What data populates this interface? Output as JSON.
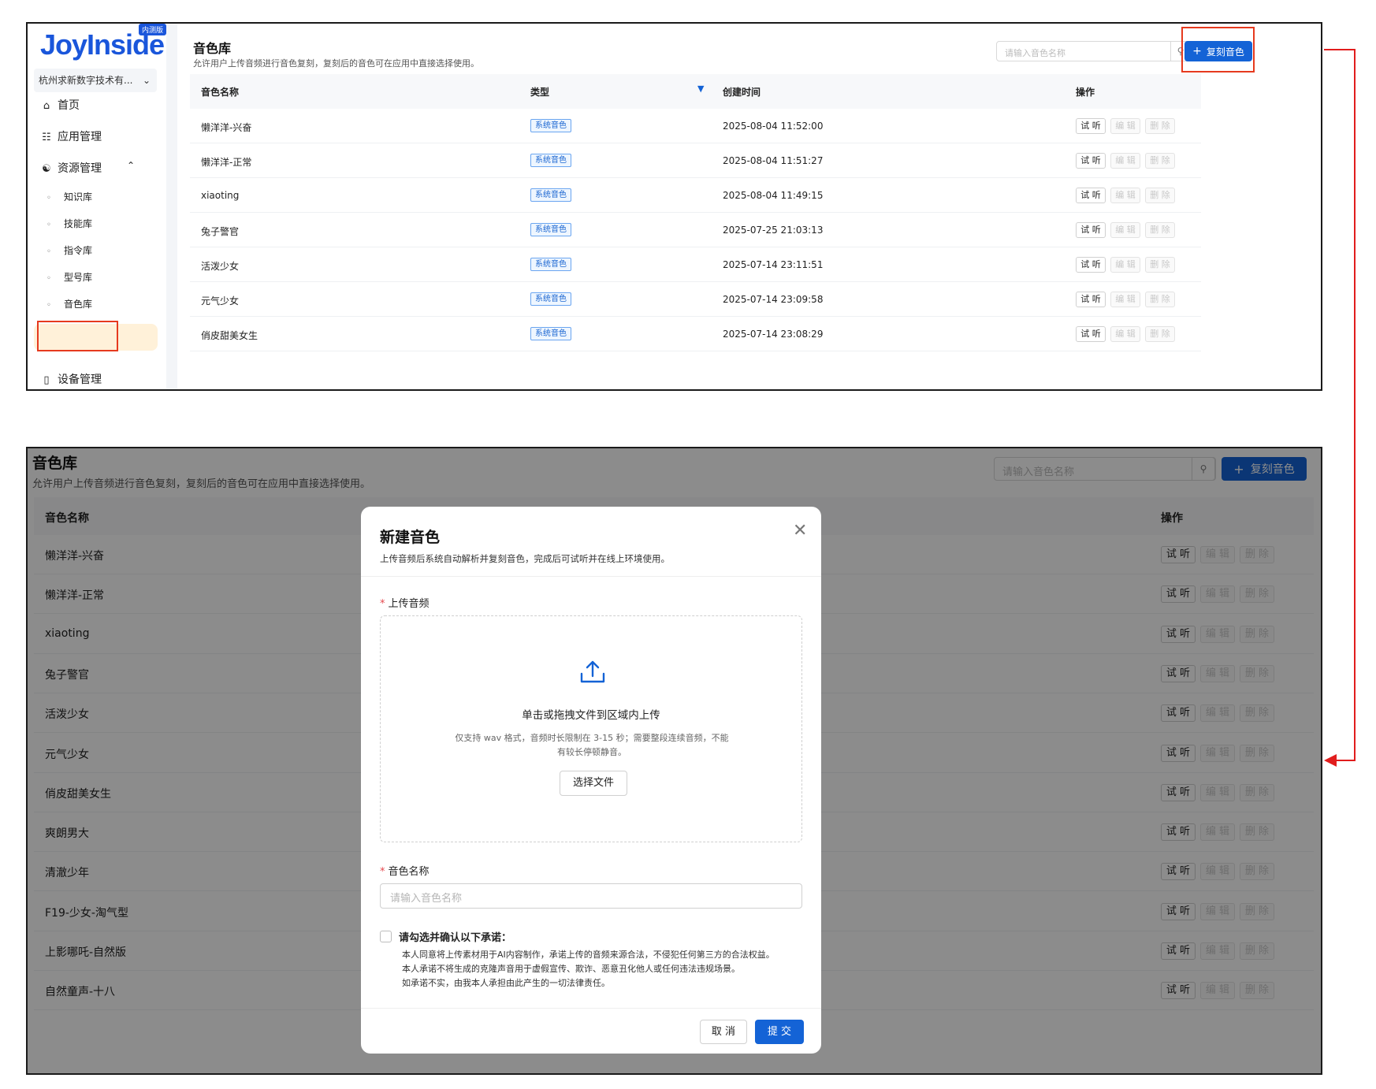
{
  "sidebar": {
    "logo": "JoyInside",
    "beta_badge": "内测版",
    "org": "杭州求新数字技术有...",
    "nav": {
      "home": "首页",
      "apps": "应用管理",
      "resources": "资源管理",
      "devices": "设备管理"
    },
    "sub_items": [
      "知识库",
      "技能库",
      "指令库",
      "型号库",
      "音色库"
    ]
  },
  "page": {
    "title": "音色库",
    "subtitle": "允许用户上传音频进行音色复刻，复刻后的音色可在应用中直接选择使用。",
    "search_placeholder": "请输入音色名称",
    "clone_button": "复刻音色"
  },
  "table": {
    "columns": {
      "name": "音色名称",
      "type": "类型",
      "created": "创建时间",
      "actions": "操作"
    },
    "rows": [
      {
        "name": "懒洋洋-兴奋",
        "type": "系统音色",
        "created": "2025-08-04 11:52:00"
      },
      {
        "name": "懒洋洋-正常",
        "type": "系统音色",
        "created": "2025-08-04 11:51:27"
      },
      {
        "name": "xiaoting",
        "type": "系统音色",
        "created": "2025-08-04 11:49:15"
      },
      {
        "name": "兔子警官",
        "type": "系统音色",
        "created": "2025-07-25 21:03:13"
      },
      {
        "name": "活泼少女",
        "type": "系统音色",
        "created": "2025-07-14 23:11:51"
      },
      {
        "name": "元气少女",
        "type": "系统音色",
        "created": "2025-07-14 23:09:58"
      },
      {
        "name": "俏皮甜美女生",
        "type": "系统音色",
        "created": "2025-07-14 23:08:29"
      }
    ],
    "actions": {
      "listen": "试 听",
      "edit": "编 辑",
      "delete": "删 除"
    }
  },
  "panel2": {
    "rows": [
      "懒洋洋-兴奋",
      "懒洋洋-正常",
      "xiaoting",
      "兔子警官",
      "活泼少女",
      "元气少女",
      "俏皮甜美女生",
      "爽朗男大",
      "清澈少年",
      "F19-少女-淘气型",
      "上影哪吒-自然版",
      "自然童声-十八"
    ]
  },
  "modal": {
    "title": "新建音色",
    "subtitle": "上传音频后系统自动解析并复刻音色，完成后可试听并在线上环境使用。",
    "upload_label": "上传音频",
    "drop_title": "单击或拖拽文件到区域内上传",
    "drop_hint_1": "仅支持 wav 格式，音频时长限制在 3-15 秒；需要整段连续音频，不能",
    "drop_hint_2": "有较长停顿静音。",
    "choose_file": "选择文件",
    "name_label": "音色名称",
    "name_placeholder": "请输入音色名称",
    "consent_title": "请勾选并确认以下承诺：",
    "consent_lines": [
      "本人同意将上传素材用于AI内容制作，承诺上传的音频来源合法，不侵犯任何第三方的合法权益。",
      "本人承诺不将生成的克隆声音用于虚假宣传、欺诈、恶意丑化他人或任何违法违规场景。",
      "如承诺不实，由我本人承担由此产生的一切法律责任。"
    ],
    "cancel": "取 消",
    "submit": "提 交"
  },
  "colors": {
    "primary": "#1463d6",
    "highlight": "#e63a1e",
    "active_bg": "#fff1d9"
  }
}
